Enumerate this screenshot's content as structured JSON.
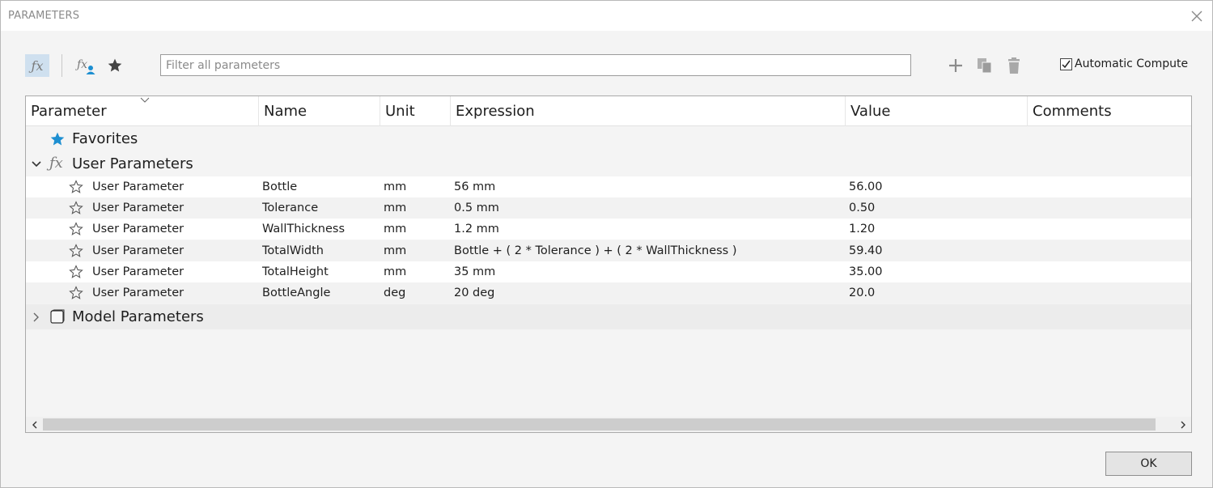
{
  "window": {
    "title": "PARAMETERS"
  },
  "toolbar": {
    "filter_placeholder": "Filter all parameters",
    "auto_compute_label": "Automatic Compute",
    "auto_compute_checked": true
  },
  "columns": [
    "Parameter",
    "Name",
    "Unit",
    "Expression",
    "Value",
    "Comments"
  ],
  "groups": {
    "favorites": "Favorites",
    "user": "User Parameters",
    "model": "Model Parameters"
  },
  "rows": [
    {
      "parameter": "User Parameter",
      "name": "Bottle",
      "unit": "mm",
      "expression": "56 mm",
      "value": "56.00",
      "comment": ""
    },
    {
      "parameter": "User Parameter",
      "name": "Tolerance",
      "unit": "mm",
      "expression": "0.5 mm",
      "value": "0.50",
      "comment": ""
    },
    {
      "parameter": "User Parameter",
      "name": "WallThickness",
      "unit": "mm",
      "expression": "1.2 mm",
      "value": "1.20",
      "comment": ""
    },
    {
      "parameter": "User Parameter",
      "name": "TotalWidth",
      "unit": "mm",
      "expression": "Bottle + ( 2 * Tolerance ) + ( 2 * WallThickness )",
      "value": "59.40",
      "comment": ""
    },
    {
      "parameter": "User Parameter",
      "name": "TotalHeight",
      "unit": "mm",
      "expression": "35 mm",
      "value": "35.00",
      "comment": ""
    },
    {
      "parameter": "User Parameter",
      "name": "BottleAngle",
      "unit": "deg",
      "expression": "20 deg",
      "value": "20.0",
      "comment": ""
    }
  ],
  "footer": {
    "ok_label": "OK"
  },
  "colors": {
    "accent_star": "#1d8fd1",
    "selected_tool": "#cfe0ef"
  }
}
